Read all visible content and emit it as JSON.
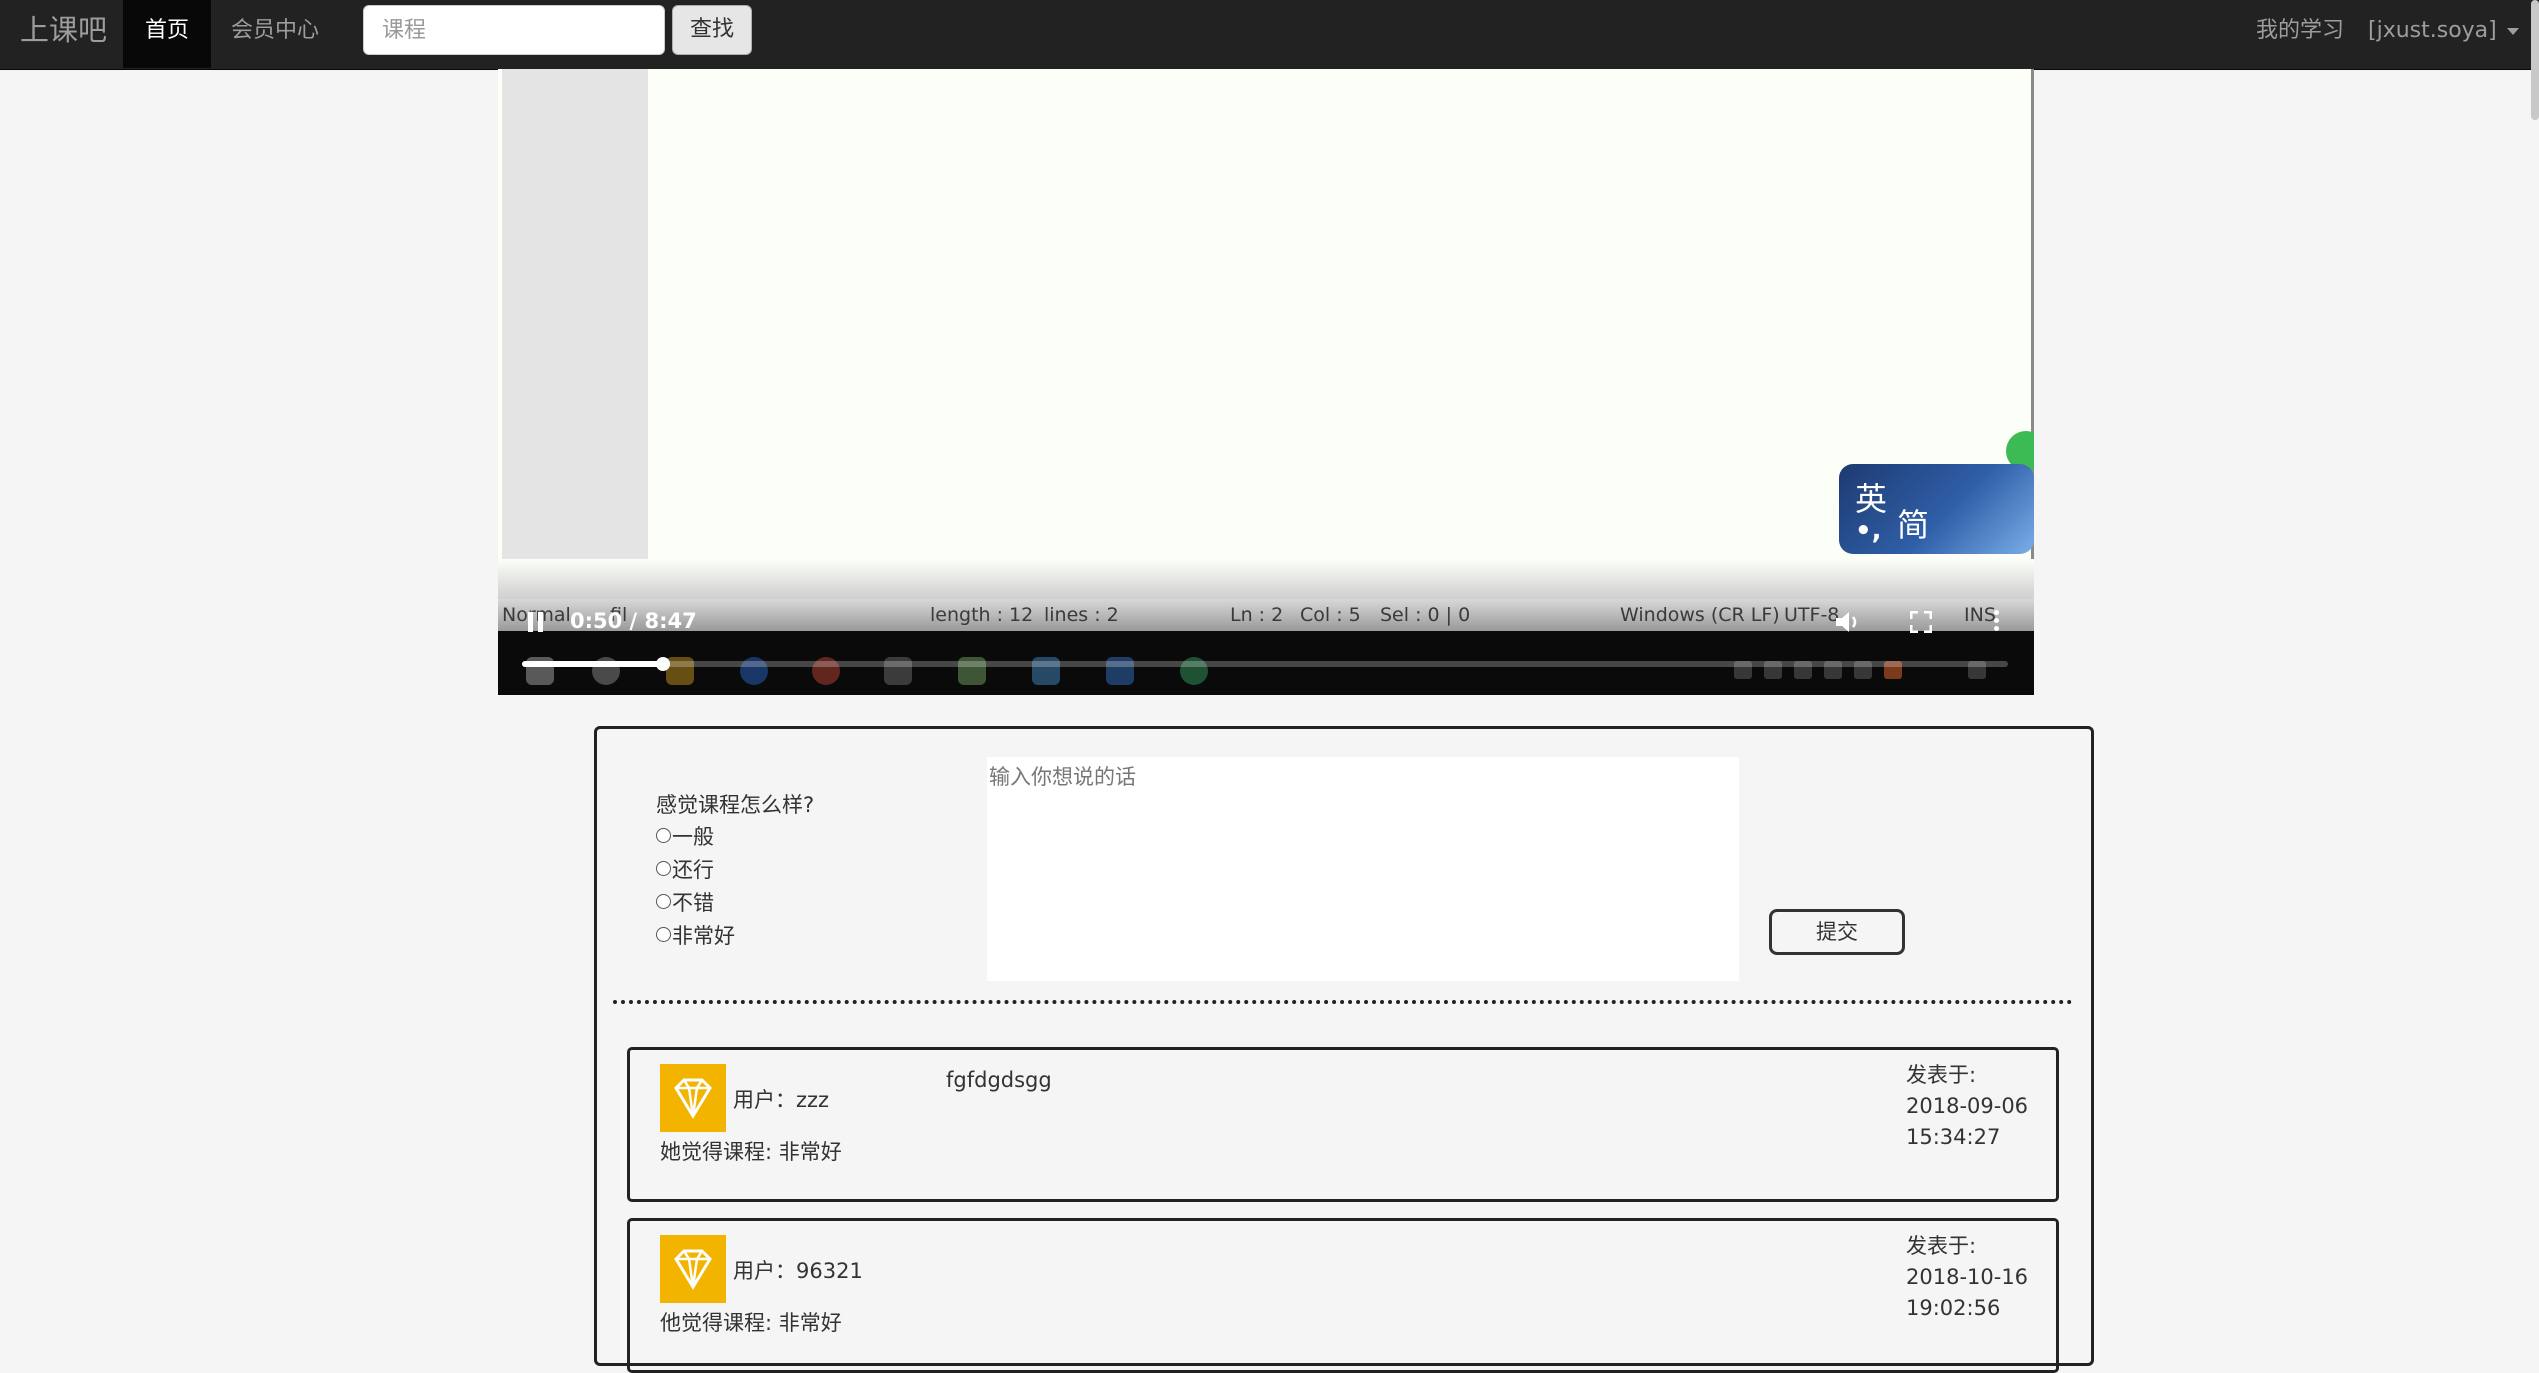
{
  "navbar": {
    "brand": "上课吧",
    "nav_home": "首页",
    "nav_member": "会员中心",
    "search_placeholder": "课程",
    "search_button": "查找",
    "my_learning": "我的学习",
    "user_menu": "[jxust.soya]"
  },
  "video": {
    "current_time": "0:50",
    "duration": "8:47",
    "time_display": "0:50 / 8:47",
    "progress_fraction": 0.095,
    "ime_text_1": "英",
    "ime_text_2": "简",
    "ime_text_3": "•,",
    "status_bar": {
      "mode": "Normal",
      "mode_suffix": "fil",
      "length": "length : 12",
      "lines": "lines : 2",
      "ln": "Ln : 2",
      "col": "Col : 5",
      "sel": "Sel : 0 | 0",
      "eol": "Windows (CR LF)",
      "encoding": "UTF-8",
      "ins": "INS"
    }
  },
  "feedback": {
    "question": "感觉课程怎么样?",
    "options": [
      "一般",
      "还行",
      "不错",
      "非常好"
    ],
    "textarea_placeholder": "输入你想说的话",
    "submit_label": "提交"
  },
  "comments": [
    {
      "user_label": "用户：zzz",
      "text": "fgfdgdsgg",
      "rating_label": "她觉得课程: 非常好",
      "posted_label": "发表于:",
      "date": "2018-09-06",
      "time": "15:34:27"
    },
    {
      "user_label": "用户：96321",
      "text": "",
      "rating_label": "他觉得课程: 非常好",
      "posted_label": "发表于:",
      "date": "2018-10-16",
      "time": "19:02:56"
    }
  ],
  "colors": {
    "navbar_bg": "#222222",
    "avatar_bg": "#f3b400",
    "page_bg": "#f5f5f5"
  }
}
